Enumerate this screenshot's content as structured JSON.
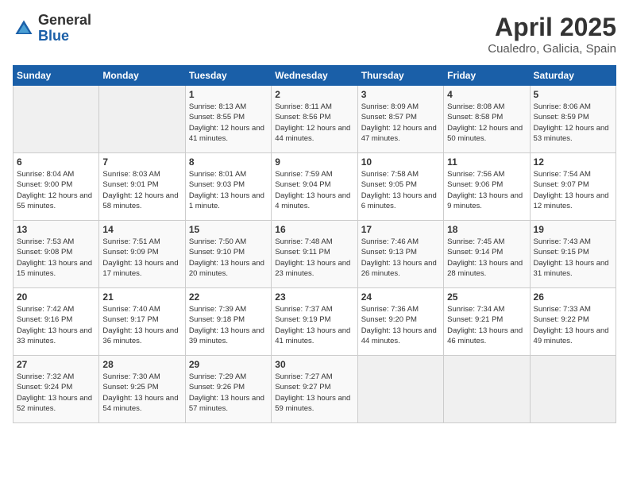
{
  "header": {
    "logo_general": "General",
    "logo_blue": "Blue",
    "month_year": "April 2025",
    "location": "Cualedro, Galicia, Spain"
  },
  "weekdays": [
    "Sunday",
    "Monday",
    "Tuesday",
    "Wednesday",
    "Thursday",
    "Friday",
    "Saturday"
  ],
  "weeks": [
    [
      {
        "day": "",
        "info": ""
      },
      {
        "day": "",
        "info": ""
      },
      {
        "day": "1",
        "info": "Sunrise: 8:13 AM\nSunset: 8:55 PM\nDaylight: 12 hours and 41 minutes."
      },
      {
        "day": "2",
        "info": "Sunrise: 8:11 AM\nSunset: 8:56 PM\nDaylight: 12 hours and 44 minutes."
      },
      {
        "day": "3",
        "info": "Sunrise: 8:09 AM\nSunset: 8:57 PM\nDaylight: 12 hours and 47 minutes."
      },
      {
        "day": "4",
        "info": "Sunrise: 8:08 AM\nSunset: 8:58 PM\nDaylight: 12 hours and 50 minutes."
      },
      {
        "day": "5",
        "info": "Sunrise: 8:06 AM\nSunset: 8:59 PM\nDaylight: 12 hours and 53 minutes."
      }
    ],
    [
      {
        "day": "6",
        "info": "Sunrise: 8:04 AM\nSunset: 9:00 PM\nDaylight: 12 hours and 55 minutes."
      },
      {
        "day": "7",
        "info": "Sunrise: 8:03 AM\nSunset: 9:01 PM\nDaylight: 12 hours and 58 minutes."
      },
      {
        "day": "8",
        "info": "Sunrise: 8:01 AM\nSunset: 9:03 PM\nDaylight: 13 hours and 1 minute."
      },
      {
        "day": "9",
        "info": "Sunrise: 7:59 AM\nSunset: 9:04 PM\nDaylight: 13 hours and 4 minutes."
      },
      {
        "day": "10",
        "info": "Sunrise: 7:58 AM\nSunset: 9:05 PM\nDaylight: 13 hours and 6 minutes."
      },
      {
        "day": "11",
        "info": "Sunrise: 7:56 AM\nSunset: 9:06 PM\nDaylight: 13 hours and 9 minutes."
      },
      {
        "day": "12",
        "info": "Sunrise: 7:54 AM\nSunset: 9:07 PM\nDaylight: 13 hours and 12 minutes."
      }
    ],
    [
      {
        "day": "13",
        "info": "Sunrise: 7:53 AM\nSunset: 9:08 PM\nDaylight: 13 hours and 15 minutes."
      },
      {
        "day": "14",
        "info": "Sunrise: 7:51 AM\nSunset: 9:09 PM\nDaylight: 13 hours and 17 minutes."
      },
      {
        "day": "15",
        "info": "Sunrise: 7:50 AM\nSunset: 9:10 PM\nDaylight: 13 hours and 20 minutes."
      },
      {
        "day": "16",
        "info": "Sunrise: 7:48 AM\nSunset: 9:11 PM\nDaylight: 13 hours and 23 minutes."
      },
      {
        "day": "17",
        "info": "Sunrise: 7:46 AM\nSunset: 9:13 PM\nDaylight: 13 hours and 26 minutes."
      },
      {
        "day": "18",
        "info": "Sunrise: 7:45 AM\nSunset: 9:14 PM\nDaylight: 13 hours and 28 minutes."
      },
      {
        "day": "19",
        "info": "Sunrise: 7:43 AM\nSunset: 9:15 PM\nDaylight: 13 hours and 31 minutes."
      }
    ],
    [
      {
        "day": "20",
        "info": "Sunrise: 7:42 AM\nSunset: 9:16 PM\nDaylight: 13 hours and 33 minutes."
      },
      {
        "day": "21",
        "info": "Sunrise: 7:40 AM\nSunset: 9:17 PM\nDaylight: 13 hours and 36 minutes."
      },
      {
        "day": "22",
        "info": "Sunrise: 7:39 AM\nSunset: 9:18 PM\nDaylight: 13 hours and 39 minutes."
      },
      {
        "day": "23",
        "info": "Sunrise: 7:37 AM\nSunset: 9:19 PM\nDaylight: 13 hours and 41 minutes."
      },
      {
        "day": "24",
        "info": "Sunrise: 7:36 AM\nSunset: 9:20 PM\nDaylight: 13 hours and 44 minutes."
      },
      {
        "day": "25",
        "info": "Sunrise: 7:34 AM\nSunset: 9:21 PM\nDaylight: 13 hours and 46 minutes."
      },
      {
        "day": "26",
        "info": "Sunrise: 7:33 AM\nSunset: 9:22 PM\nDaylight: 13 hours and 49 minutes."
      }
    ],
    [
      {
        "day": "27",
        "info": "Sunrise: 7:32 AM\nSunset: 9:24 PM\nDaylight: 13 hours and 52 minutes."
      },
      {
        "day": "28",
        "info": "Sunrise: 7:30 AM\nSunset: 9:25 PM\nDaylight: 13 hours and 54 minutes."
      },
      {
        "day": "29",
        "info": "Sunrise: 7:29 AM\nSunset: 9:26 PM\nDaylight: 13 hours and 57 minutes."
      },
      {
        "day": "30",
        "info": "Sunrise: 7:27 AM\nSunset: 9:27 PM\nDaylight: 13 hours and 59 minutes."
      },
      {
        "day": "",
        "info": ""
      },
      {
        "day": "",
        "info": ""
      },
      {
        "day": "",
        "info": ""
      }
    ]
  ]
}
